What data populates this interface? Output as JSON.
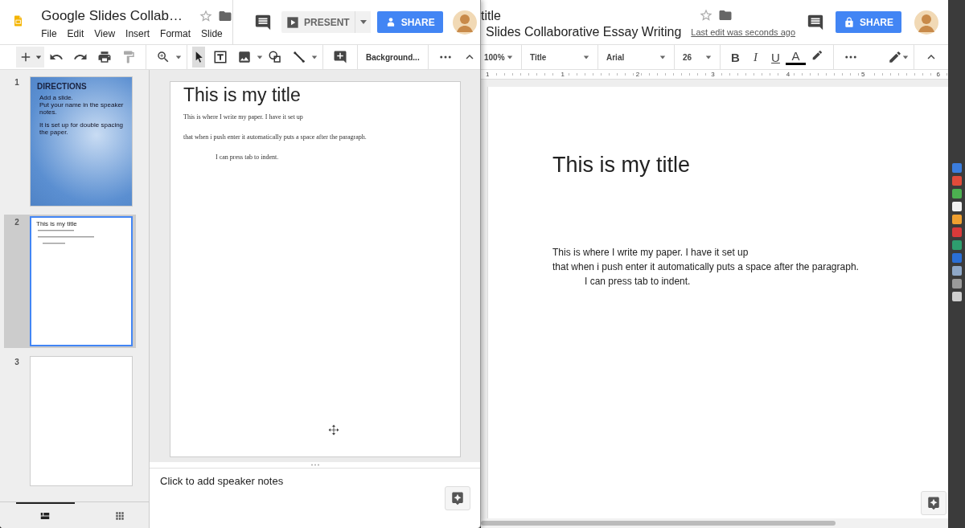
{
  "slides_window": {
    "title": "Google Slides Collab…",
    "menu": [
      "File",
      "Edit",
      "View",
      "Insert",
      "Format",
      "Slide"
    ],
    "present_label": "PRESENT",
    "share_label": "SHARE",
    "background_label": "Background...",
    "filmstrip": [
      {
        "number": "1",
        "selected": false,
        "kind": "directions",
        "heading": "DIRECTIONS",
        "paragraphs": [
          {
            "lines": [
              "Add a slide.",
              "Put your name in the speaker notes."
            ]
          },
          {
            "lines": [
              "It is set up for double spacing the paper."
            ]
          }
        ]
      },
      {
        "number": "2",
        "selected": true,
        "kind": "text",
        "heading": "This is my title"
      },
      {
        "number": "3",
        "selected": false,
        "kind": "blank"
      }
    ],
    "view_tabs": [
      {
        "kind": "filmstrip",
        "selected": true
      },
      {
        "kind": "grid",
        "selected": false
      }
    ],
    "slide": {
      "title": "This is my title",
      "paragraphs": [
        {
          "text": "This is where I write my paper. I have it set up",
          "indent": false
        },
        {
          "text": "that when i push enter it automatically puts a space after the paragraph.",
          "indent": false
        },
        {
          "text": "I can press tab to indent.",
          "indent": true
        }
      ]
    },
    "notes_placeholder": "Click to add speaker notes"
  },
  "docs_window": {
    "title": "title",
    "overlay_title": "Slides Collaborative Essay Writing",
    "last_edit": "Last edit was seconds ago",
    "share_label": "SHARE",
    "toolbar": {
      "zoom": "100%",
      "style": "Title",
      "font": "Arial",
      "size": "26"
    },
    "format_buttons": [
      {
        "kind": "bold",
        "label": "B"
      },
      {
        "kind": "italic",
        "label": "I"
      },
      {
        "kind": "underline",
        "label": "U"
      },
      {
        "kind": "color",
        "label": "A"
      }
    ],
    "ruler_labels": [
      "1",
      "1",
      "2",
      "3",
      "4",
      "5",
      "6"
    ],
    "page": {
      "title": "This is my title",
      "paragraphs": [
        {
          "text": "This is where I write my paper. I have it set up",
          "indent": false
        },
        {
          "text": "that when i push enter it automatically puts a space after the paragraph.",
          "indent": false
        },
        {
          "text": "I can press tab to indent.",
          "indent": true
        }
      ]
    }
  },
  "dock": [
    {
      "color": "#3b7ddd"
    },
    {
      "color": "#e04b3a"
    },
    {
      "color": "#4caf50"
    },
    {
      "color": "#f2f2f2"
    },
    {
      "color": "#f0a030"
    },
    {
      "color": "#d93a3a"
    },
    {
      "color": "#2e9e6e"
    },
    {
      "color": "#2a6fd6"
    },
    {
      "color": "#8fa8c8"
    },
    {
      "color": "#9a9a9a"
    },
    {
      "color": "#cfcfcf"
    }
  ]
}
